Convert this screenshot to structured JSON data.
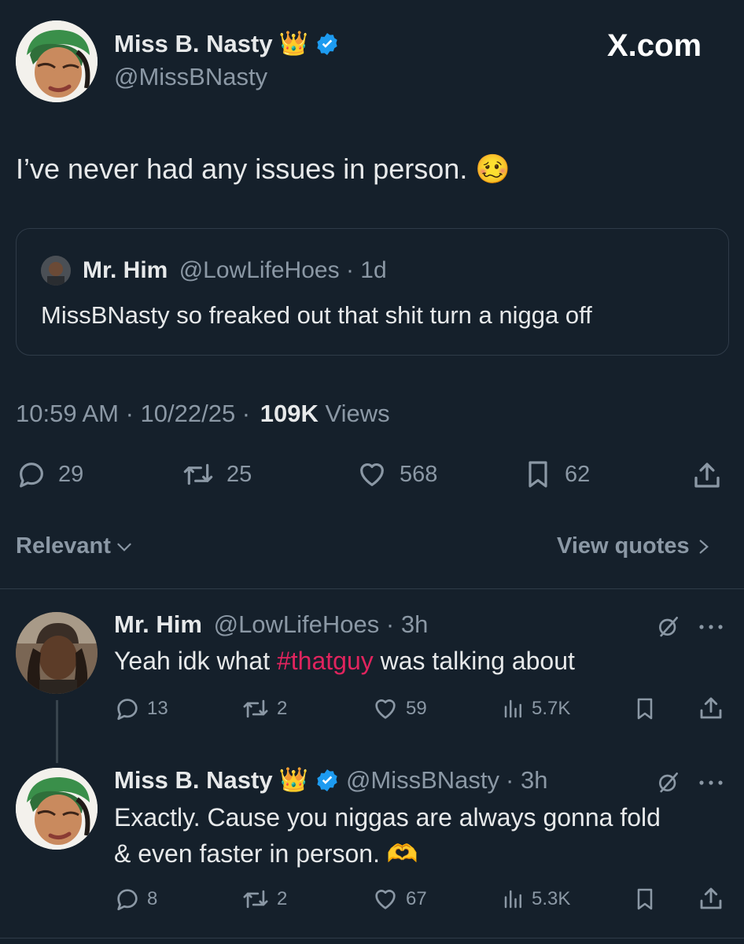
{
  "main_tweet": {
    "author_name": "Miss B. Nasty",
    "author_handle": "@MissBNasty",
    "crown_emoji": "👑",
    "site_mark": "X.com",
    "text": "I’ve never had any issues in person.",
    "text_emoji": "🥴",
    "quoted": {
      "author_name": "Mr. Him",
      "author_handle": "@LowLifeHoes",
      "age": "· 1d",
      "text": "MissBNasty so freaked out that shit turn a nigga off"
    },
    "time": "10:59 AM · 10/22/25 ·",
    "views_count": "109K",
    "views_label": "Views",
    "stats": {
      "replies": "29",
      "reposts": "25",
      "likes": "568",
      "bookmarks": "62"
    }
  },
  "sort": {
    "relevant_label": "Relevant",
    "view_quotes_label": "View quotes"
  },
  "replies": [
    {
      "author_name": "Mr. Him",
      "author_handle": "@LowLifeHoes",
      "age": "· 3h",
      "text_before": "Yeah idk what ",
      "hashtag": "#thatguy",
      "text_after": " was talking about",
      "stats": {
        "replies": "13",
        "reposts": "2",
        "likes": "59",
        "views": "5.7K"
      }
    },
    {
      "author_name": "Miss B. Nasty",
      "author_handle": "@MissBNasty",
      "age": "· 3h",
      "crown_emoji": "👑",
      "line1": "Exactly. Cause you niggas are always gonna fold",
      "line2": "& even faster in person.",
      "heart_hands_emoji": "🫶",
      "stats": {
        "replies": "8",
        "reposts": "2",
        "likes": "67",
        "views": "5.3K"
      }
    }
  ],
  "colors": {
    "background": "#15202b",
    "text": "#e7e9ea",
    "muted": "#8b98a5",
    "verified": "#1d9bf0",
    "hashtag": "#e0245e",
    "border": "#2f3b48"
  }
}
